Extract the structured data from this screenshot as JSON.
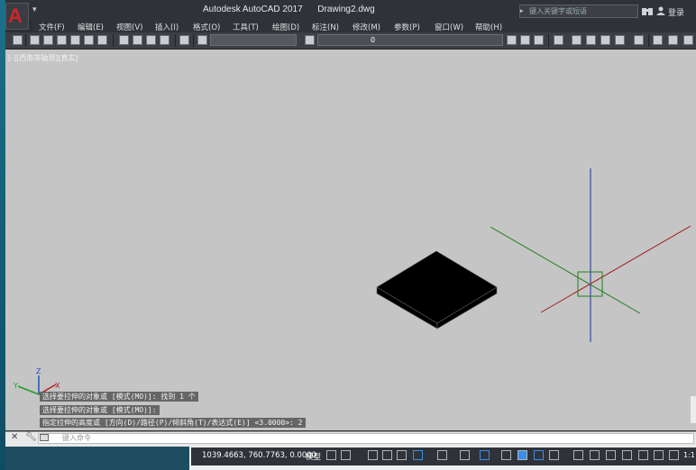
{
  "app": {
    "logo_letter": "A",
    "window_title": "Autodesk AutoCAD 2017      Drawing2.dwg"
  },
  "search": {
    "placeholder": "键入关键字或短语"
  },
  "user": {
    "login_label": "登录"
  },
  "menu": [
    "文件(F)",
    "编辑(E)",
    "视图(V)",
    "插入(I)",
    "格式(O)",
    "工具(T)",
    "绘图(D)",
    "标注(N)",
    "修改(M)",
    "参数(P)",
    "窗口(W)",
    "帮助(H)"
  ],
  "toolbar": {
    "layer_value": "0"
  },
  "viewport": {
    "label": "[-][西南等轴测][真实]"
  },
  "command_history": [
    "选择要拉伸的对象或 [模式(MO)]: 找到 1 个",
    "选择要拉伸的对象或 [模式(MO)]:",
    "指定拉伸的高度或 [方向(D)/路径(P)/倾斜角(T)/表达式(E)] <3.0000>: 2"
  ],
  "command_input": {
    "placeholder": "键入命令"
  },
  "status": {
    "coordinates": "1039.4663, 760.7763, 0.0000",
    "model_label": "模型",
    "scale": "1:1"
  },
  "ucs_icon": {
    "x_label": "X",
    "y_label": "Y",
    "z_label": "Z"
  },
  "colors": {
    "canvas_bg": "#c5c5c5",
    "x_axis": "#a02020",
    "y_axis": "#208020",
    "z_axis": "#2030a0",
    "solid": "#000000"
  }
}
